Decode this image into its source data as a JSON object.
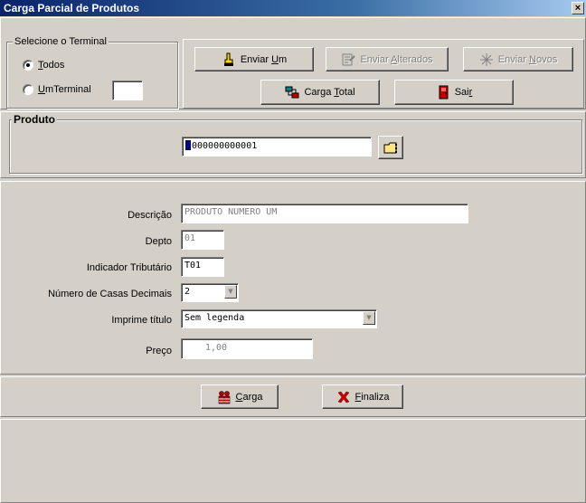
{
  "window": {
    "title": "Carga Parcial de Produtos",
    "close_label": "×"
  },
  "terminal_group": {
    "legend": "Selecione o Terminal",
    "todos_underlined": "T",
    "todos_rest": "odos",
    "um_underlined": "U",
    "um_rest": "mTerminal",
    "terminal_value": "",
    "selected": "todos"
  },
  "toolbar": {
    "enviar_um_prefix": "Enviar ",
    "enviar_um_underlined": "U",
    "enviar_um_suffix": "m",
    "enviar_alterados_prefix": "Enviar ",
    "enviar_alterados_underlined": "A",
    "enviar_alterados_suffix": "lterados",
    "enviar_novos_prefix": "Enviar ",
    "enviar_novos_underlined": "N",
    "enviar_novos_suffix": "ovos",
    "carga_total_prefix": "Carga ",
    "carga_total_underlined": "T",
    "carga_total_suffix": "otal",
    "sair_prefix": "Sai",
    "sair_underlined": "r"
  },
  "produto": {
    "legend": "Produto",
    "code": "000000000001"
  },
  "fields": {
    "descricao_label": "Descrição",
    "descricao_value": "PRODUTO NUMERO UM",
    "depto_label": "Depto",
    "depto_value": "01",
    "indicador_label": "Indicador Tributário",
    "indicador_value": "T01",
    "casas_label": "Número de Casas Decimais",
    "casas_value": "2",
    "imprime_label": "Imprime título",
    "imprime_value": "Sem legenda",
    "preco_label": "Preço",
    "preco_value": "1,00"
  },
  "actions": {
    "carga_underlined": "C",
    "carga_rest": "arga",
    "finaliza_underlined": "F",
    "finaliza_rest": "inaliza"
  },
  "colors": {
    "title_bar": "#0a246a",
    "face": "#d4d0c8",
    "finaliza_x": "#cc0000"
  }
}
